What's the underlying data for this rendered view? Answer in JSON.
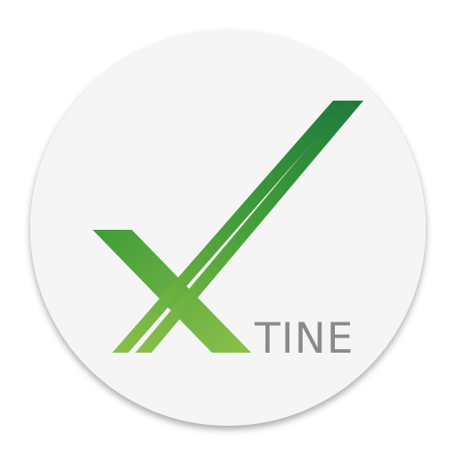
{
  "app_icon": {
    "wordmark": "TINE",
    "glyph_icon": "x-stripes-icon",
    "colors": {
      "disc": "#f5f5f5",
      "disc_shadow": "#d0d0d0",
      "green_dark": "#1f7a3c",
      "green_mid": "#3f9c38",
      "green_light": "#8cc04a",
      "wordmark": "#8a8a8a"
    }
  }
}
